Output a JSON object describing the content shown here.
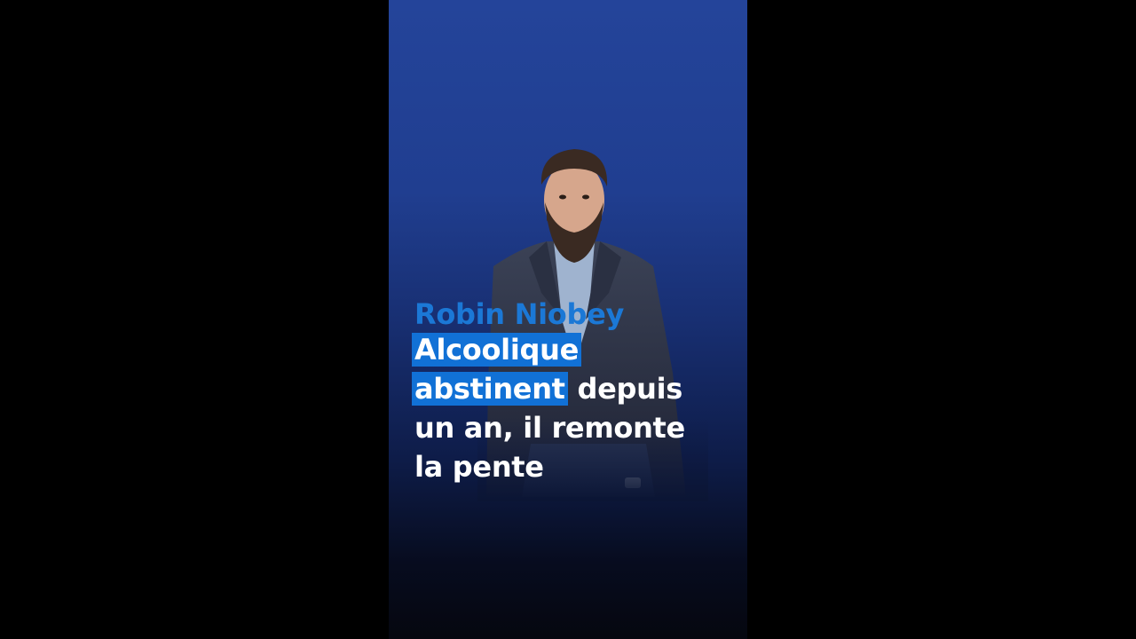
{
  "overlay": {
    "name": "Robin Niobey",
    "title_highlight_1": "Alcoolique",
    "title_highlight_2": "abstinent",
    "title_rest_1": " depuis",
    "title_line_3": "un an, il remonte",
    "title_line_4": "la pente"
  },
  "colors": {
    "background_top": "#24449a",
    "background_bottom": "#05070f",
    "name_color": "#1b78d6",
    "highlight": "#1171d6",
    "text": "#ffffff"
  },
  "image": {
    "subject": "bearded man in grey plaid blazer"
  }
}
